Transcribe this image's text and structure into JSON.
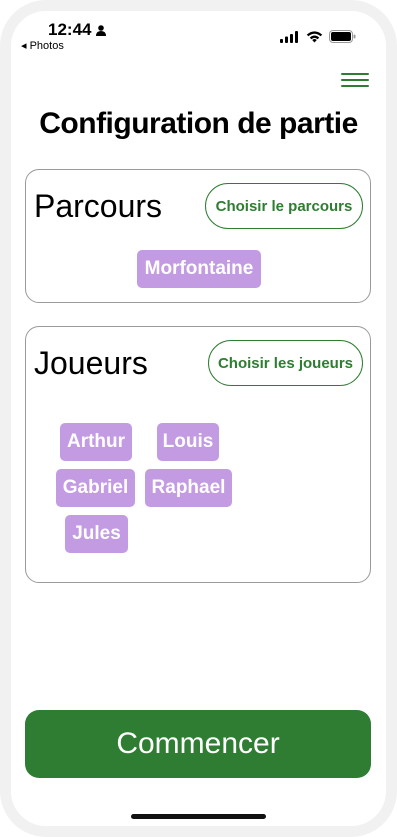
{
  "status_bar": {
    "time": "12:44",
    "back_label": "◂ Photos",
    "icons": [
      "person-icon",
      "signal-icon",
      "wifi-icon",
      "battery-icon"
    ]
  },
  "header": {
    "menu_icon": "hamburger-menu-icon",
    "title": "Configuration de partie"
  },
  "parcours": {
    "title": "Parcours",
    "choose_label": "Choisir le parcours",
    "selected": [
      "Morfontaine"
    ]
  },
  "joueurs": {
    "title": "Joueurs",
    "choose_label": "Choisir les joueurs",
    "players": [
      "Arthur",
      "Louis",
      "Gabriel",
      "Raphael",
      "Jules"
    ]
  },
  "start_label": "Commencer",
  "colors": {
    "accent": "#2e7d32",
    "chip": "#c39be3",
    "border": "#9a9a9a"
  }
}
